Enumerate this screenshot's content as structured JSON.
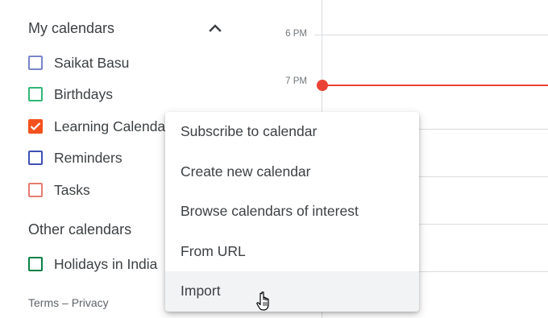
{
  "sidebar": {
    "my_calendars": {
      "title": "My calendars",
      "items": [
        {
          "label": "Saikat Basu",
          "color": "#7986cb",
          "checked": false
        },
        {
          "label": "Birthdays",
          "color": "#33b679",
          "checked": false
        },
        {
          "label": "Learning Calendar",
          "color": "#f4511e",
          "checked": true
        },
        {
          "label": "Reminders",
          "color": "#3f51b5",
          "checked": false
        },
        {
          "label": "Tasks",
          "color": "#e67c73",
          "checked": false
        }
      ]
    },
    "other_calendars": {
      "title": "Other calendars",
      "items": [
        {
          "label": "Holidays in India",
          "color": "#0b8043",
          "checked": false
        }
      ]
    },
    "footer": {
      "terms": "Terms",
      "separator": "–",
      "privacy": "Privacy"
    }
  },
  "grid": {
    "time_labels": [
      "6 PM",
      "7 PM"
    ],
    "now_indicator_color": "#ea4335"
  },
  "menu": {
    "items": [
      {
        "label": "Subscribe to calendar"
      },
      {
        "label": "Create new calendar"
      },
      {
        "label": "Browse calendars of interest"
      },
      {
        "label": "From URL"
      },
      {
        "label": "Import",
        "hovered": true
      }
    ]
  },
  "icons": {
    "collapse": "chevron-up-icon",
    "checkmark": "check-icon",
    "cursor": "hand-pointer-icon"
  }
}
